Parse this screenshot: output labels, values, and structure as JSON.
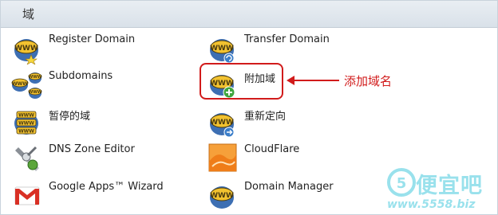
{
  "header": {
    "title": "域"
  },
  "items": [
    {
      "label": "Register Domain",
      "icon": "www-star-icon"
    },
    {
      "label": "Transfer Domain",
      "icon": "www-refresh-icon"
    },
    {
      "label": "Subdomains",
      "icon": "www-multiple-icon"
    },
    {
      "label": "附加域",
      "icon": "www-plus-icon"
    },
    {
      "label": "暂停的域",
      "icon": "www-stack-icon"
    },
    {
      "label": "重新定向",
      "icon": "www-redirect-icon"
    },
    {
      "label": "DNS Zone Editor",
      "icon": "dns-tools-icon"
    },
    {
      "label": "CloudFlare",
      "icon": "cloudflare-icon"
    },
    {
      "label": "Google Apps™ Wizard",
      "icon": "gmail-icon"
    },
    {
      "label": "Domain Manager",
      "icon": "www-manager-icon"
    }
  ],
  "annotation": {
    "text": "添加域名"
  },
  "watermark": {
    "title": "便宜吧",
    "url": "www.5558.biz"
  },
  "colors": {
    "accent": "#d11b1b",
    "header_bg": "#dfe6ed",
    "www_gold": "#f2c230",
    "www_dark": "#4a3b10"
  }
}
